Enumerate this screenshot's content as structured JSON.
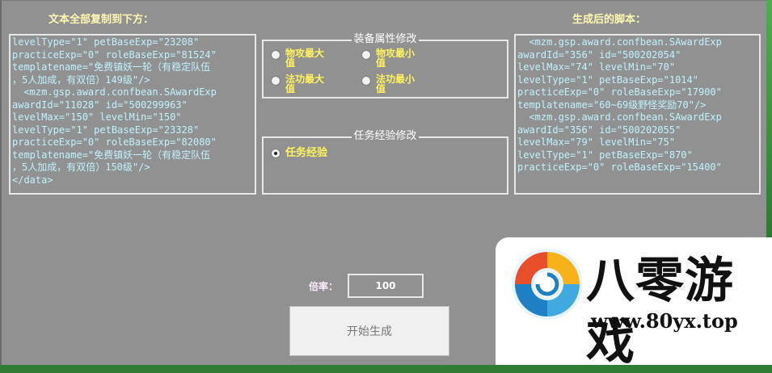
{
  "left": {
    "heading": "文本全部复制到下方：",
    "text": "levelType=\"1\" petBaseExp=\"23208\"\npracticeExp=\"0\" roleBaseExp=\"81524\"\ntemplatename=\"免费镇妖一轮（有稳定队伍\n，5人加成，有双倍）149级\"/>\n  <mzm.gsp.award.confbean.SAwardExp\nawardId=\"11028\" id=\"500299963\"\nlevelMax=\"150\" levelMin=\"150\"\nlevelType=\"1\" petBaseExp=\"23328\"\npracticeExp=\"0\" roleBaseExp=\"82080\"\ntemplatename=\"免费镇妖一轮（有稳定队伍\n，5人加成，有双倍）150级\"/>\n</data>"
  },
  "equip_group": {
    "title": "装备属性修改",
    "options": [
      {
        "label": "物攻最大值",
        "selected": false
      },
      {
        "label": "物攻最小值",
        "selected": false
      },
      {
        "label": "法功最大值",
        "selected": false
      },
      {
        "label": "法功最小值",
        "selected": false
      }
    ]
  },
  "task_group": {
    "title": "任务经验修改",
    "option": {
      "label": "任务经验",
      "selected": true
    }
  },
  "right": {
    "heading": "生成后的脚本：",
    "text": "  <mzm.gsp.award.confbean.SAwardExp\nawardId=\"356\" id=\"500202054\"\nlevelMax=\"74\" levelMin=\"70\"\nlevelType=\"1\" petBaseExp=\"1014\"\npracticeExp=\"0\" roleBaseExp=\"17900\"\ntemplatename=\"60~69级野怪奖励70\"/>\n  <mzm.gsp.award.confbean.SAwardExp\nawardId=\"356\" id=\"500202055\"\nlevelMax=\"79\" levelMin=\"75\"\nlevelType=\"1\" petBaseExp=\"870\"\npracticeExp=\"0\" roleBaseExp=\"15400\""
  },
  "rate": {
    "label": "倍率：",
    "value": "100"
  },
  "generate_button": "开始生成",
  "watermark": {
    "name": "八零游戏",
    "url": "www.80yx.top"
  }
}
